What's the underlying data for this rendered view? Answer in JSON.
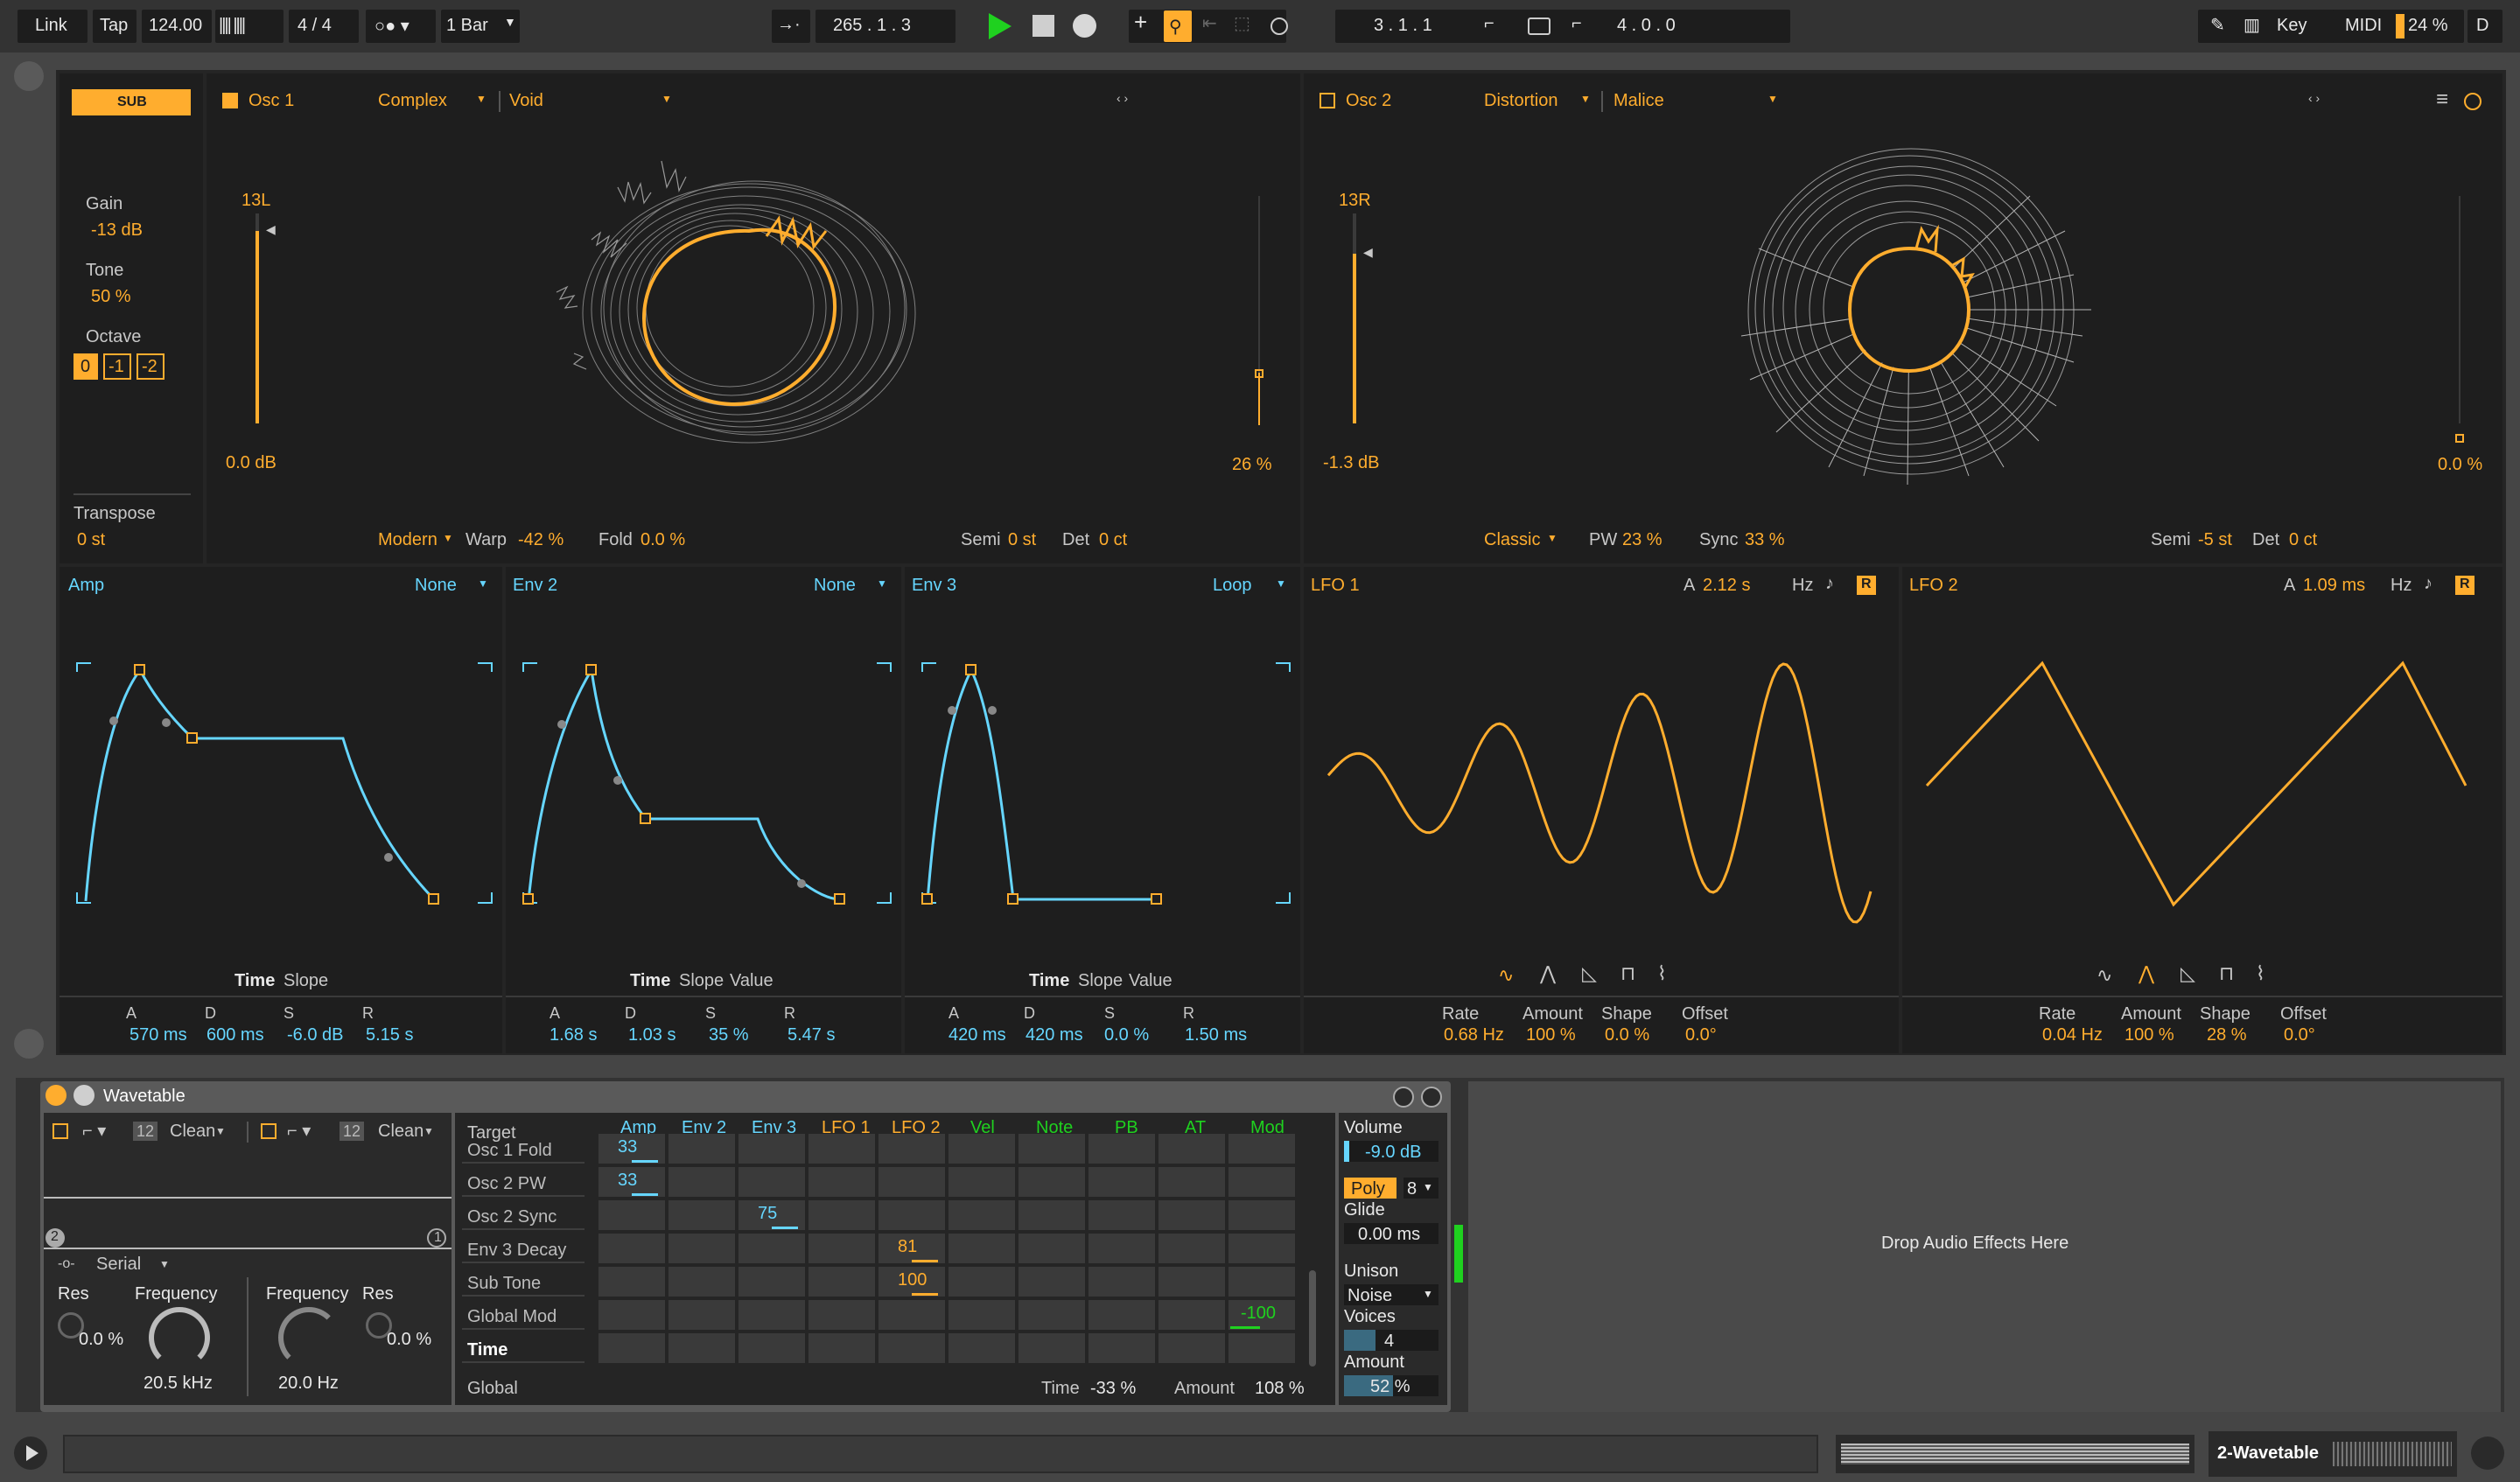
{
  "transport": {
    "link": "Link",
    "tap": "Tap",
    "tempo": "124.00",
    "meter": "4 / 4",
    "quantize": "1 Bar",
    "position": "265 .  1 .  3",
    "loop_start": "3 .  1 .  1",
    "loop_length": "4 .  0 .  0",
    "key": "Key",
    "midi": "MIDI",
    "cpu": "24 %",
    "d": "D"
  },
  "colors": {
    "accent": "#ffad2e",
    "mod_blue": "#66d6ff",
    "green": "#1fd11f",
    "panel": "#1e1e1e"
  },
  "sub": {
    "badge": "SUB",
    "gain_label": "Gain",
    "gain_value": "-13 dB",
    "tone_label": "Tone",
    "tone_value": "50 %",
    "octave_label": "Octave",
    "octave_options": [
      "0",
      "-1",
      "-2"
    ],
    "transpose_label": "Transpose",
    "transpose_value": "0 st"
  },
  "osc1": {
    "title": "Osc 1",
    "category": "Complex",
    "wavetable": "Void",
    "level_label": "13L",
    "gain_value": "0.0 dB",
    "mix_value": "26 %",
    "effect_mode": "Modern",
    "warp_label": "Warp",
    "warp_value": "-42 %",
    "fold_label": "Fold",
    "fold_value": "0.0 %",
    "semi_label": "Semi",
    "semi_value": "0 st",
    "det_label": "Det",
    "det_value": "0 ct"
  },
  "osc2": {
    "title": "Osc 2",
    "category": "Distortion",
    "wavetable": "Malice",
    "level_label": "13R",
    "gain_value": "-1.3 dB",
    "mix_value": "0.0 %",
    "effect_mode": "Classic",
    "pw_label": "PW",
    "pw_value": "23 %",
    "sync_label": "Sync",
    "sync_value": "33 %",
    "semi_label": "Semi",
    "semi_value": "-5 st",
    "det_label": "Det",
    "det_value": "0 ct"
  },
  "envs": [
    {
      "title": "Amp",
      "loop": "None",
      "tabs": [
        "Time",
        "Slope"
      ],
      "a_label": "A",
      "a": "570 ms",
      "d_label": "D",
      "d": "600 ms",
      "s_label": "S",
      "s": "-6.0 dB",
      "r_label": "R",
      "r": "5.15 s"
    },
    {
      "title": "Env 2",
      "loop": "None",
      "tabs": [
        "Time",
        "Slope",
        "Value"
      ],
      "a_label": "A",
      "a": "1.68 s",
      "d_label": "D",
      "d": "1.03 s",
      "s_label": "S",
      "s": "35 %",
      "r_label": "R",
      "r": "5.47 s"
    },
    {
      "title": "Env 3",
      "loop": "Loop",
      "tabs": [
        "Time",
        "Slope",
        "Value"
      ],
      "a_label": "A",
      "a": "420 ms",
      "d_label": "D",
      "d": "420 ms",
      "s_label": "S",
      "s": "0.0 %",
      "r_label": "R",
      "r": "1.50 ms"
    }
  ],
  "lfos": [
    {
      "title": "LFO 1",
      "a_label": "A",
      "a_value": "2.12 s",
      "unit": "Hz",
      "r": "R",
      "rate_label": "Rate",
      "rate": "0.68 Hz",
      "amount_label": "Amount",
      "amount": "100 %",
      "shape_label": "Shape",
      "shape": "0.0 %",
      "offset_label": "Offset",
      "offset": "0.0°"
    },
    {
      "title": "LFO 2",
      "a_label": "A",
      "a_value": "1.09 ms",
      "unit": "Hz",
      "r": "R",
      "rate_label": "Rate",
      "rate": "0.04 Hz",
      "amount_label": "Amount",
      "amount": "100 %",
      "shape_label": "Shape",
      "shape": "28 %",
      "offset_label": "Offset",
      "offset": "0.0°"
    }
  ],
  "device": {
    "title": "Wavetable",
    "filter1_circuit": "Clean",
    "filter2_circuit": "Clean",
    "slope1": "12",
    "slope2": "12",
    "routing": "Serial",
    "res_label": "Res",
    "res1": "0.0 %",
    "freq_label": "Frequency",
    "freq1": "20.5 kHz",
    "freq2": "20.0 Hz",
    "res2": "0.0 %",
    "marker1": "1",
    "marker2": "2"
  },
  "matrix": {
    "target_header": "Target",
    "sources": [
      "Amp",
      "Env 2",
      "Env 3",
      "LFO 1",
      "LFO 2",
      "Vel",
      "Note",
      "PB",
      "AT",
      "Mod"
    ],
    "rows": [
      {
        "name": "Osc 1 Fold",
        "cells": [
          "33",
          "",
          "",
          "",
          "",
          "",
          "",
          "",
          "",
          ""
        ]
      },
      {
        "name": "Osc 2 PW",
        "cells": [
          "33",
          "",
          "",
          "",
          "",
          "",
          "",
          "",
          "",
          ""
        ]
      },
      {
        "name": "Osc 2 Sync",
        "cells": [
          "",
          "",
          "75",
          "",
          "",
          "",
          "",
          "",
          "",
          ""
        ]
      },
      {
        "name": "Env 3 Decay",
        "cells": [
          "",
          "",
          "",
          "",
          "81",
          "",
          "",
          "",
          "",
          ""
        ]
      },
      {
        "name": "Sub Tone",
        "cells": [
          "",
          "",
          "",
          "",
          "100",
          "",
          "",
          "",
          "",
          ""
        ]
      },
      {
        "name": "Global Mod",
        "cells": [
          "",
          "",
          "",
          "",
          "",
          "",
          "",
          "",
          "",
          "-100"
        ]
      },
      {
        "name": "Time",
        "cells": [
          "",
          "",
          "",
          "",
          "",
          "",
          "",
          "",
          "",
          ""
        ]
      }
    ],
    "global_label": "Global",
    "time_label": "Time",
    "time_value": "-33 %",
    "amount_label": "Amount",
    "amount_value": "108 %"
  },
  "voice": {
    "volume_label": "Volume",
    "volume_value": "-9.0 dB",
    "poly": "Poly",
    "poly_count": "8",
    "glide_label": "Glide",
    "glide_value": "0.00 ms",
    "unison_label": "Unison",
    "unison_value": "Noise",
    "voices_label": "Voices",
    "voices_value": "4",
    "amount_label": "Amount",
    "amount_value": "52 %"
  },
  "drop_zone": "Drop Audio Effects Here",
  "statusbar": {
    "track_name": "2-Wavetable"
  }
}
